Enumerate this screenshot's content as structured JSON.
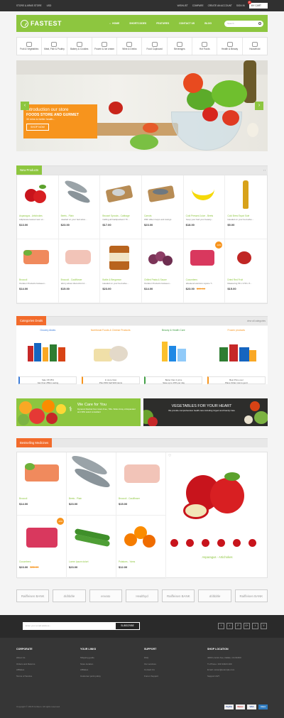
{
  "topbar": {
    "store": "STORE & ARMS STORE",
    "currency": "USD",
    "wishlist": "WISHLIST",
    "compare": "COMPARE",
    "create": "CREATE AN ACCOUNT",
    "signin": "SIGN IN",
    "cart": "MY CART",
    "cart_count": "0"
  },
  "header": {
    "logo": "FASTEST",
    "nav": [
      "HOME",
      "SHORTCODES",
      "FEATURES",
      "CONTACT US",
      "BLOG"
    ],
    "search_placeholder": "Search"
  },
  "categories": [
    "Fruit & Vegetables",
    "Meat, Fish & Poultry",
    "Bakery & Cookies",
    "Frozen & Ice cream",
    "Wine & Drinks",
    "Food Cupboard",
    "Beverages",
    "Hot Foods",
    "Health & Beauty",
    "Household"
  ],
  "hero": {
    "line1": "Introduction our store",
    "line2": "FOODS STORE AND GURMET",
    "line3": "30 mins to better health...",
    "button": "SHOP NOW"
  },
  "new_products": {
    "title": "New Products",
    "items": [
      {
        "name": "Asparagus - Artichokes",
        "desc": "Adipiscele laoreet sem et...",
        "price": "$13.00",
        "old": ""
      },
      {
        "name": "Beets - Plain",
        "desc": "Headed on your bed adve...",
        "price": "$23.00",
        "old": ""
      },
      {
        "name": "Brussel Sprouts - Cabbage",
        "desc": "Calling all backpackers! Th...",
        "price": "$17.00",
        "old": ""
      },
      {
        "name": "Carrots",
        "desc": "With silken loops and swings",
        "price": "$23.00",
        "old": ""
      },
      {
        "name": "Cold Pressed Juice - Beets",
        "desc": "Keep your bed your beauty...",
        "price": "$18.00",
        "old": ""
      },
      {
        "name": "Cold Brew Espot Sole",
        "desc": "Headed on your bed adve...",
        "price": "$5.00",
        "old": ""
      },
      {
        "name": "Broccoli",
        "desc": "Outdoor Products between...",
        "price": "$14.00",
        "old": ""
      },
      {
        "name": "Broccoli - Cauliflower",
        "desc": "Worry about discomfort A...",
        "price": "$15.00",
        "old": ""
      },
      {
        "name": "Bottle & Bergamon",
        "desc": "Headed on your bed adve...",
        "price": "$23.00",
        "old": ""
      },
      {
        "name": "Chilled Pasta & Sauce",
        "desc": "Outdoor Products between...",
        "price": "$14.00",
        "old": ""
      },
      {
        "name": "Cucumbers",
        "desc": "Weekend warriors rejoice T...",
        "price": "$23.00",
        "old": "$35.00",
        "badge": "-10%"
      },
      {
        "name": "Dried Red Fruit",
        "desc": "Measuring 5ft x 3.5ft x 5...",
        "price": "$15.00",
        "old": ""
      }
    ]
  },
  "deals": {
    "title": "Categories Deals",
    "view_all": "view all categories",
    "cols": [
      {
        "name": "Grocery Aisles",
        "line1": "Sale Off 25%",
        "line2": "Get Over 25$ in saving"
      },
      {
        "name": "Nutritional Foods & Cheese Products",
        "line1": "In store Now",
        "line2": "Plus 50% Sell With items"
      },
      {
        "name": "Beauty & Health Care",
        "line1": "Better than 2 price",
        "line2": "Save up to 15% per day"
      },
      {
        "name": "Frozen products",
        "line1": "Best Price ever",
        "line2": "Place Order now to get it"
      }
    ]
  },
  "banner_left": {
    "title": "We Care for You",
    "text": "Dynamic Medical from Grain Free, 700+ Wider Array of Expanded and 30% select consultant"
  },
  "banner_right": {
    "title": "VEGETABLES FOR YOUR HEART",
    "text": "We provide comprehensive health care including Urgent and Family Care"
  },
  "bestselling": {
    "title": "Bestselling Medicines",
    "items": [
      {
        "name": "Broccoli",
        "price": "$14.00",
        "old": ""
      },
      {
        "name": "Beets - Plain",
        "price": "$23.00",
        "old": ""
      },
      {
        "name": "Broccoli - Cauliflower",
        "price": "$15.00",
        "old": ""
      },
      {
        "name": "Cucumbers",
        "price": "$23.00",
        "old": "$35.00",
        "badge": "-10%"
      },
      {
        "name": "Lorem Ipsum dolort",
        "price": "$23.00",
        "old": ""
      },
      {
        "name": "Potatoes - Yams",
        "price": "$12.00",
        "old": ""
      }
    ],
    "featured": "Asparagus - Artichokes"
  },
  "brands": [
    "Raiffeisen BANK",
    "dribbble",
    "envato",
    "Healthyd",
    "Raiffeisen BANK",
    "dribbble",
    "Raiffeisen BANK"
  ],
  "footer": {
    "newsletter_placeholder": "Enter your email address...",
    "subscribe": "SUBSCRIBE",
    "social": [
      "f",
      "t",
      "P",
      "G+",
      "t",
      "V"
    ],
    "cols": [
      {
        "title": "CORPORATE",
        "items": [
          "About Us",
          "Orders and Returns",
          "Affiliates",
          "Terms of Service"
        ]
      },
      {
        "title": "YOUR LINKS",
        "items": [
          "Shipping guide",
          "Store location",
          "Affiliates",
          "Customer point policy"
        ]
      },
      {
        "title": "SUPPORT",
        "items": [
          "FAQ",
          "Our services",
          "Contact Us",
          "Forum Support"
        ]
      },
      {
        "title": "SHOP LOCATION",
        "items": [
          "4200 Lincoln Ave, Dallas, CA 91600",
          "Tu Phone: 230 33423 200",
          "Email: owner@example.com",
          "Support 24/7"
        ]
      }
    ],
    "copyright": "Copyright © 2018 Corlleon. All rights reserved.",
    "payments": [
      "PayPal",
      "Master",
      "VISA",
      "Amex"
    ]
  }
}
